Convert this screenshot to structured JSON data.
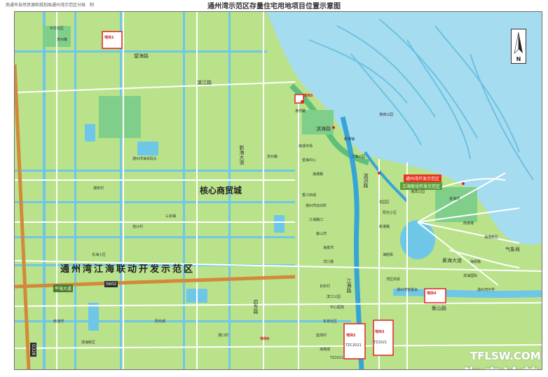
{
  "header": {
    "title": "通州湾示范区存量住宅用地项目位置示意图",
    "credit": "南通市自然资源和规划局通州湾示范区分局　制"
  },
  "compass": {
    "north_label": "N"
  },
  "zones": {
    "core": "核心商贸城",
    "demo_zone": "通州湾江海联动开发示范区"
  },
  "roads": {
    "binjiang": "滨江路",
    "wangqiao": "望海路",
    "pinghai": "平海大道",
    "s602": "S602",
    "g328": "G328",
    "huanghai": "黄海大道",
    "xinhai": "新海大道",
    "binhai": "滨海路",
    "binhe": "滨河路",
    "jiangjiang": "江海路",
    "binlan": "滨江路",
    "qidong": "启东路",
    "hengshan": "衡山路",
    "qixiang": "气象局"
  },
  "places": [
    "中华社区",
    "苏州路",
    "潮桥村",
    "连兴村",
    "通州湾海关码头",
    "苏州路",
    "南通市场",
    "望海中心",
    "海港路",
    "香江商城",
    "通州湾派出所",
    "江海路口",
    "紫山湾",
    "海景湾",
    "港城公园",
    "洋口港",
    "花园区",
    "阳光小区",
    "新港路",
    "长岭村",
    "滨江公园",
    "中心医院",
    "海鸥街",
    "湾区商贸",
    "通州湾管委会",
    "金海湾",
    "通州湾开发示范区",
    "江海联动开发示范区",
    "南通港",
    "海港新区",
    "三余镇",
    "东海小区",
    "南通湾",
    "滨海新区",
    "港湾路",
    "新港镇",
    "海滨公园",
    "江海公园",
    "海晏路",
    "滨海国际",
    "通州湾中学",
    "东安社区",
    "盐场村",
    "海港城",
    "阳光城",
    "港口村"
  ],
  "plots": [
    "地块1",
    "地块2",
    "地块3",
    "地块4",
    "地块5",
    "地块6"
  ],
  "plot_codes": [
    "TZC2021",
    "TZ2021",
    "TZ2021"
  ],
  "watermark": {
    "url": "TFLSW.COM",
    "name": "淘房论势"
  },
  "colors": {
    "land": "#b9e28a",
    "sea": "#9ad9ee",
    "river": "#6fc7e7",
    "park": "#7fcf8a",
    "road": "#ffffff",
    "expressway": "#d28a3a",
    "plot_red": "#e0221f"
  }
}
